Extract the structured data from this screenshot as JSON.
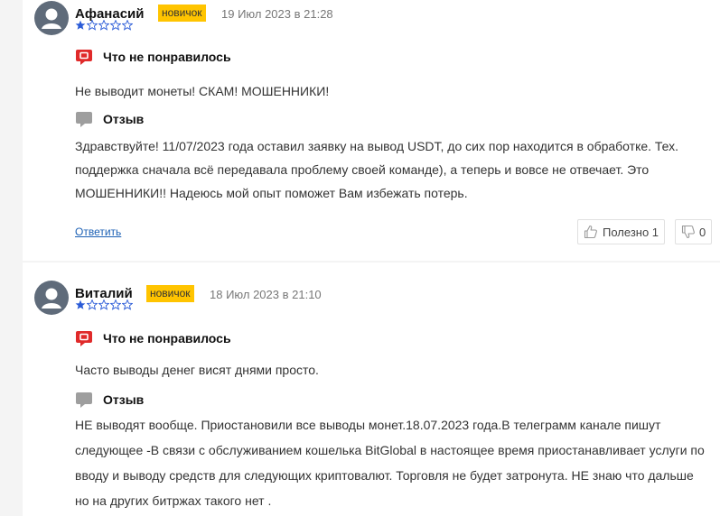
{
  "colors": {
    "badge": "#ffc400",
    "dislike_icon": "#e02a2a",
    "review_icon": "#9e9e9e",
    "star": "#2a5bd7",
    "link": "#1a5fb4"
  },
  "icons": {
    "avatar": "user-avatar-icon",
    "dislike": "dislike-speech-bubble-icon",
    "review": "review-speech-bubble-icon",
    "useful": "thumbs-up-icon",
    "useless": "thumbs-down-icon"
  },
  "reviews": [
    {
      "author": "Афанасий",
      "badge": "новичок",
      "date": "19 Июл 2023 в 21:28",
      "rating": 1,
      "rating_max": 5,
      "dislike_title": "Что не понравилось",
      "dislike_text": "Не выводит монеты! СКАМ! МОШЕННИКИ!",
      "review_title": "Отзыв",
      "review_text": "Здравствуйте! 11/07/2023 года оставил заявку на вывод USDT, до сих пор находится в обработке. Тех. поддержка сначала всё передавала проблему своей команде), а теперь и вовсе не отвечает. Это МОШЕННИКИ!! Надеюсь мой опыт поможет Вам избежать потерь.",
      "reply_label": "Ответить",
      "useful_label": "Полезно 1",
      "useless_count": "0"
    },
    {
      "author": "Виталий",
      "badge": "новичок",
      "date": "18 Июл 2023 в 21:10",
      "rating": 1,
      "rating_max": 5,
      "dislike_title": "Что не понравилось",
      "dislike_text": "Часто выводы денег висят днями просто.",
      "review_title": "Отзыв",
      "review_text": "НЕ выводят вообще. Приостановили все выводы монет.18.07.2023 года.В телеграмм канале пишут следующее -В связи с обслуживанием кошелька BitGlobal в настоящее время приостанавливает услуги по вводу и выводу средств для следующих криптовалют. Торговля не будет затронута. НЕ знаю что дальше но на других битржах такого нет ."
    }
  ]
}
